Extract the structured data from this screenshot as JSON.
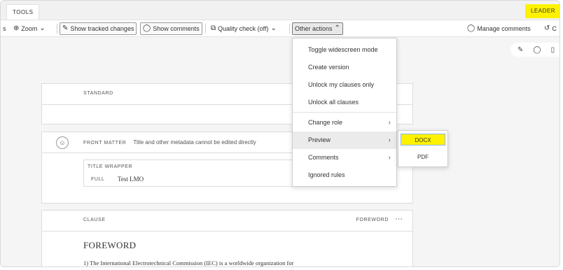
{
  "tabs": {
    "tools": "TOOLS"
  },
  "role_badge": "LEADER",
  "toolbar": {
    "left_fragment": "s",
    "zoom": "Zoom",
    "show_tracked_changes": "Show tracked changes",
    "show_comments": "Show comments",
    "quality_check": "Quality check (off)",
    "other_actions": "Other actions",
    "manage_comments": "Manage comments",
    "truncated_right": "C"
  },
  "document": {
    "standard_label": "STANDARD",
    "front_matter_label": "FRONT MATTER",
    "front_matter_note": "Title and other metadata cannot be edited directly",
    "title_wrapper_label": "TITLE WRAPPER",
    "full_label": "FULL",
    "full_value": "Test LMO",
    "clause_label": "CLAUSE",
    "clause_tag": "FOREWORD",
    "clause_more": "···",
    "clause_title": "FOREWORD",
    "clause_body": "1) The International Electrotechnical Commission (IEC) is a worldwide organization for"
  },
  "menu": {
    "items": [
      {
        "label": "Toggle widescreen mode"
      },
      {
        "label": "Create version"
      },
      {
        "label": "Unlock my clauses only"
      },
      {
        "label": "Unlock all clauses"
      },
      {
        "label": "Change role"
      },
      {
        "label": "Preview"
      },
      {
        "label": "Comments"
      },
      {
        "label": "Ignored rules"
      }
    ]
  },
  "submenu": {
    "items": [
      {
        "label": "DOCX"
      },
      {
        "label": "PDF"
      }
    ]
  },
  "colors": {
    "highlight_yellow": "#fff200",
    "selection_border": "#8ab4ff"
  },
  "icons": [
    "zoom-icon",
    "tracked-changes-icon",
    "comment-icon",
    "quality-check-icon",
    "chevron-down-icon",
    "chevron-up-icon",
    "chevron-right-icon",
    "edit-icon",
    "history-icon",
    "person-icon",
    "more-icon"
  ]
}
